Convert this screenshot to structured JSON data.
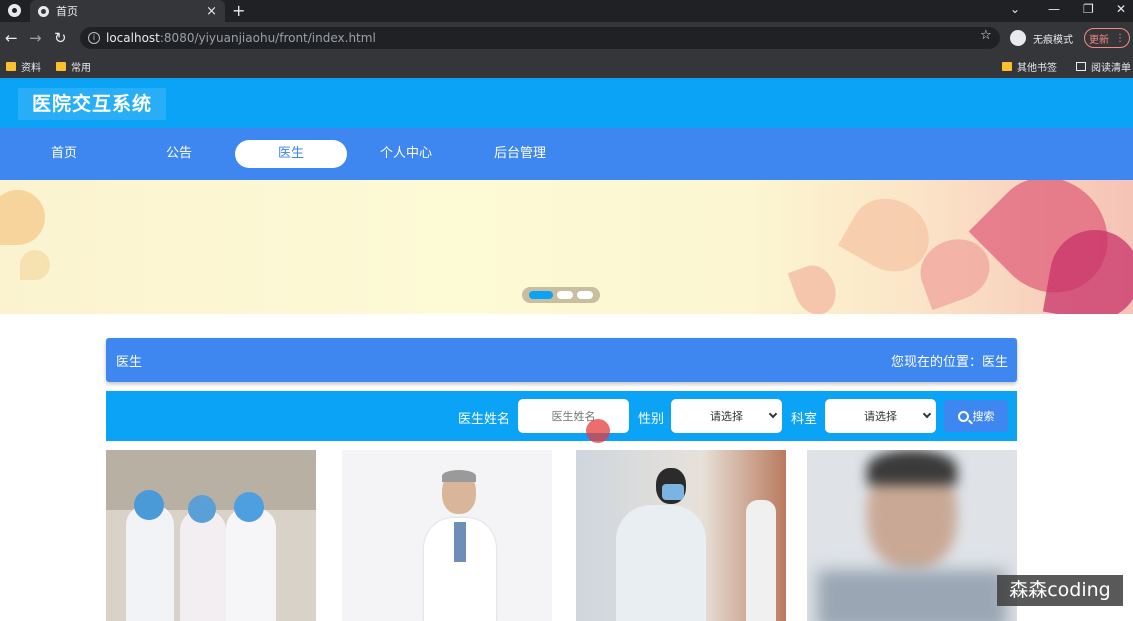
{
  "browser": {
    "tab_title": "首页",
    "url_host": "localhost",
    "url_path": ":8080/yiyuanjiaohu/front/index.html",
    "incognito_label": "无痕模式",
    "update_label": "更新",
    "bookmarks": [
      "资料",
      "常用"
    ],
    "bookmarks_right": [
      "其他书签",
      "阅读清单"
    ]
  },
  "site": {
    "logo": "医院交互系统",
    "nav": [
      "首页",
      "公告",
      "医生",
      "个人中心",
      "后台管理"
    ],
    "active_nav": "医生"
  },
  "banner": {
    "slides": 3,
    "active_slide": 1
  },
  "breadcrumb": {
    "title": "医生",
    "location": "您现在的位置：医生"
  },
  "search": {
    "name_label": "医生姓名",
    "name_placeholder": "医生姓名",
    "gender_label": "性别",
    "gender_value": "请选择",
    "dept_label": "科室",
    "dept_value": "请选择",
    "button": "搜索"
  },
  "watermark": "森森coding",
  "colors": {
    "header": "#0aa3f5",
    "nav": "#3e86f0"
  }
}
